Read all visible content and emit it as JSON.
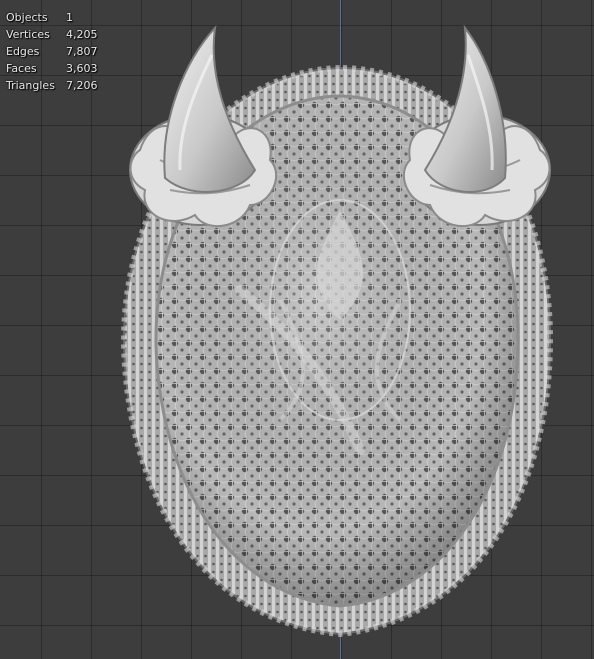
{
  "viewport": {
    "background": "#3d3d3d",
    "grid_color": "#2a2a2a",
    "z_axis_color": "#5a78b8"
  },
  "stats": [
    {
      "label": "Objects",
      "value": "1"
    },
    {
      "label": "Vertices",
      "value": "4,205"
    },
    {
      "label": "Edges",
      "value": "7,807"
    },
    {
      "label": "Faces",
      "value": "3,603"
    },
    {
      "label": "Triangles",
      "value": "7,206"
    }
  ],
  "model": {
    "colors": {
      "surface": "#bdbdbd",
      "highlight": "#e2e2e2",
      "shadow": "#6e6e6e",
      "lace_hole": "#4a4a4a"
    }
  }
}
